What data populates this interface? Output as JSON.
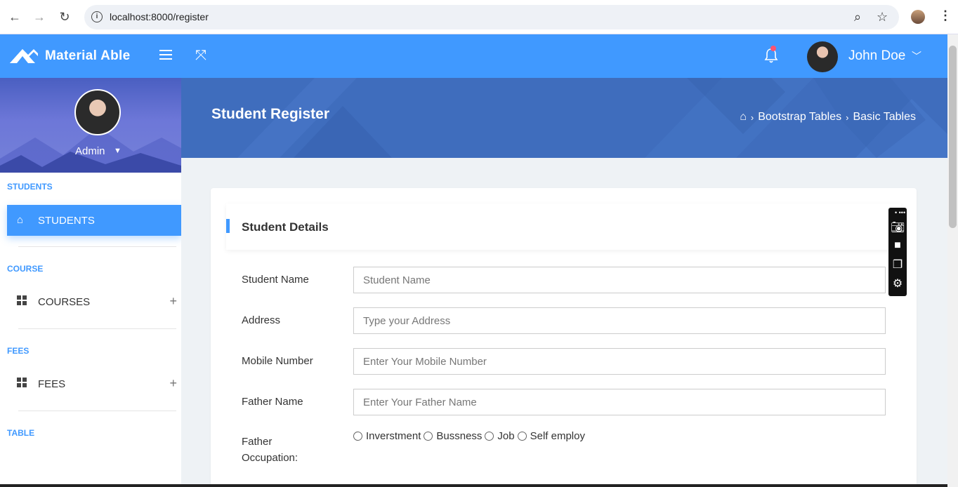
{
  "browser": {
    "url": "localhost:8000/register"
  },
  "header": {
    "logo_text": "Material Able",
    "user_name": "John Doe"
  },
  "sidebar": {
    "admin_name": "Admin",
    "sections": [
      {
        "caption": "STUDENTS"
      },
      {
        "caption": "COURSE"
      },
      {
        "caption": "FEES"
      },
      {
        "caption": "TABLE"
      }
    ],
    "items": [
      {
        "label": "STUDENTS",
        "active": true
      },
      {
        "label": "COURSES"
      },
      {
        "label": "FEES"
      }
    ]
  },
  "banner": {
    "title": "Student Register",
    "breadcrumbs": [
      "Bootstrap Tables",
      "Basic Tables"
    ]
  },
  "form": {
    "card_title": "Student Details",
    "fields": [
      {
        "label": "Student Name",
        "placeholder": "Student Name"
      },
      {
        "label": "Address",
        "placeholder": "Type your Address"
      },
      {
        "label": "Mobile Number",
        "placeholder": "Enter Your Mobile Number"
      },
      {
        "label": "Father Name",
        "placeholder": "Enter Your Father Name"
      }
    ],
    "occupation_label_1": "Father",
    "occupation_label_2": "Occupation:",
    "occupation_options": [
      "Inverstment",
      "Bussness",
      "Job",
      "Self employ"
    ]
  },
  "colors": {
    "primary": "#4099ff",
    "banner": "#3f6dbd"
  }
}
